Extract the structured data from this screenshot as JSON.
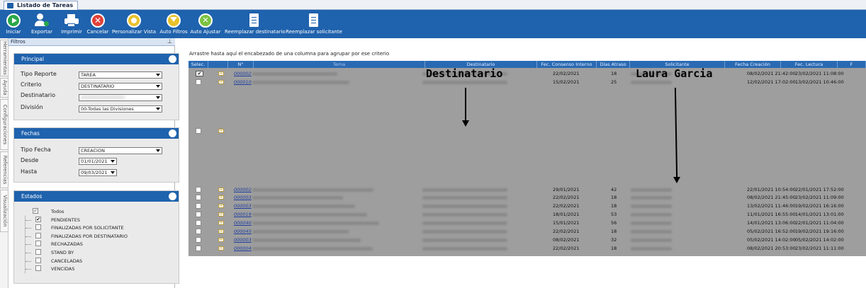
{
  "window": {
    "tab_title": "Listado de Tareas"
  },
  "toolbar": {
    "buttons": [
      {
        "label": "Iniciar",
        "icon": "play-icon"
      },
      {
        "label": "Exportar",
        "icon": "export-user-icon"
      },
      {
        "label": "Imprimir",
        "icon": "printer-icon"
      },
      {
        "label": "Cancelar",
        "icon": "cancel-icon"
      },
      {
        "label": "Personalizar Vista",
        "icon": "customize-view-icon"
      },
      {
        "label": "Auto Filtros",
        "icon": "auto-filter-icon"
      },
      {
        "label": "Auto Ajustar",
        "icon": "auto-adjust-icon"
      },
      {
        "label": "Reemplazar destinatario",
        "icon": "replace-document-icon"
      },
      {
        "label": "Reemplazar solicitante",
        "icon": "replace-document-icon"
      }
    ]
  },
  "side_tabs": [
    "Herramientas",
    "Ayuda",
    "Configuraciones",
    "Referencias",
    "Visualización"
  ],
  "filters": {
    "title": "Filtros",
    "pin": "↑",
    "principal": {
      "title": "Principal",
      "tipo_reporte": {
        "label": "Tipo Reporte",
        "value": "TAREA"
      },
      "criterio": {
        "label": "Criterio",
        "value": "DESTINATARIO"
      },
      "destinatario": {
        "label": "Destinatario",
        "value": "XXXXXXXXXXXXXX"
      },
      "division": {
        "label": "División",
        "value": "00-Todas las Divisiones"
      }
    },
    "fechas": {
      "title": "Fechas",
      "tipo_fecha": {
        "label": "Tipo Fecha",
        "value": "CREACION"
      },
      "desde": {
        "label": "Desde",
        "value": "01/01/2021"
      },
      "hasta": {
        "label": "Hasta",
        "value": "09/03/2021"
      }
    },
    "estados": {
      "title": "Estados",
      "items": [
        {
          "label": "Todos",
          "checked": true,
          "root": true
        },
        {
          "label": "PENDIENTES",
          "checked": true
        },
        {
          "label": "FINALIZADAS POR SOLICITANTE",
          "checked": false
        },
        {
          "label": "FINALIZADAS POR DESTINATARIO",
          "checked": false
        },
        {
          "label": "RECHAZADAS",
          "checked": false
        },
        {
          "label": "STAND BY",
          "checked": false
        },
        {
          "label": "CANCELADAS",
          "checked": false
        },
        {
          "label": "VENCIDAS",
          "checked": false
        }
      ]
    }
  },
  "grid": {
    "group_hint": "Arrastre hasta aquí el encabezado de una columna para agrupar por ese criterio",
    "columns": [
      "Selec.",
      "",
      "N°",
      "Tema",
      "Destinatario",
      "Fec. Consenso Interno",
      "Días Atraso",
      "Solicitante",
      "Fecha Creación",
      "Fec. Lectura",
      "F"
    ],
    "rows": [
      {
        "checked": true,
        "num": "000002",
        "consenso": "22/02/2021",
        "atraso": "18",
        "creacion": "08/02/2021 21:42:00",
        "lectura": "23/02/2021 11:08:00"
      },
      {
        "checked": false,
        "num": "000010",
        "consenso": "15/02/2021",
        "atraso": "25",
        "creacion": "12/02/2021 17:02:00",
        "lectura": "13/02/2021 10:46:00"
      },
      {
        "checked": false,
        "num": "",
        "consenso": "",
        "atraso": "",
        "creacion": "",
        "lectura": ""
      },
      {
        "checked": false,
        "num": "000002",
        "consenso": "29/01/2021",
        "atraso": "42",
        "creacion": "22/01/2021 10:54:00",
        "lectura": "22/01/2021 17:52:00"
      },
      {
        "checked": false,
        "num": "000003",
        "consenso": "22/02/2021",
        "atraso": "18",
        "creacion": "08/02/2021 21:45:00",
        "lectura": "23/02/2021 11:09:00"
      },
      {
        "checked": false,
        "num": "000003",
        "consenso": "22/02/2021",
        "atraso": "18",
        "creacion": "13/02/2021 11:46:00",
        "lectura": "19/02/2021 16:16:00"
      },
      {
        "checked": false,
        "num": "000019",
        "consenso": "18/01/2021",
        "atraso": "53",
        "creacion": "11/01/2021 16:55:00",
        "lectura": "14/01/2021 13:01:00"
      },
      {
        "checked": false,
        "num": "000040",
        "consenso": "15/01/2021",
        "atraso": "56",
        "creacion": "14/01/2021 13:06:00",
        "lectura": "22/01/2021 11:04:00"
      },
      {
        "checked": false,
        "num": "000045",
        "consenso": "22/02/2021",
        "atraso": "18",
        "creacion": "05/02/2021 16:52:00",
        "lectura": "19/02/2021 19:16:00"
      },
      {
        "checked": false,
        "num": "000003",
        "consenso": "08/02/2021",
        "atraso": "32",
        "creacion": "05/02/2021 14:02:00",
        "lectura": "05/02/2021 14:02:00"
      },
      {
        "checked": false,
        "num": "000004",
        "consenso": "22/02/2021",
        "atraso": "18",
        "creacion": "08/02/2021 20:53:00",
        "lectura": "23/02/2021 11:11:00"
      }
    ]
  },
  "annotations": {
    "destinatario": "Destinatario",
    "solicitante": "Laura Garcia"
  },
  "colors": {
    "toolbar": "#1f62ad",
    "grid_header": "#2a6ab3",
    "grid_body": "#9e9e9e"
  }
}
